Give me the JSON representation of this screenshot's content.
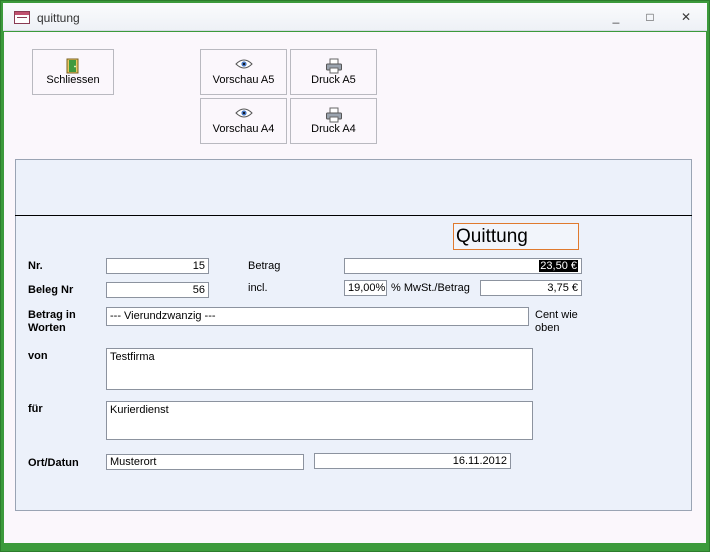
{
  "window": {
    "title": "quittung",
    "controls": {
      "minimize": "_",
      "maximize": "□",
      "close": "✕"
    }
  },
  "toolbar": {
    "close_label": "Schliessen",
    "preview_a5_label": "Vorschau A5",
    "print_a5_label": "Druck A5",
    "preview_a4_label": "Vorschau A4",
    "print_a4_label": "Druck A4"
  },
  "form": {
    "heading": "Quittung",
    "nr_label": "Nr.",
    "nr_value": "15",
    "beleg_label": "Beleg Nr",
    "beleg_value": "56",
    "betrag_label": "Betrag",
    "betrag_value": "23,50 €",
    "incl_label": "incl.",
    "mwst_percent": "19,00%",
    "mwst_label": "% MwSt./Betrag",
    "mwst_amount": "3,75 €",
    "betrag_worten_label_line1": "Betrag in",
    "betrag_worten_label_line2": "Worten",
    "betrag_worten_value": "--- Vierundzwanzig ---",
    "cent_note_line1": "Cent wie",
    "cent_note_line2": "oben",
    "von_label": "von",
    "von_value": "Testfirma",
    "fuer_label": "für",
    "fuer_value": "Kurierdienst",
    "ort_datum_label": "Ort/Datun",
    "ort_value": "Musterort",
    "datum_value": "16.11.2012"
  }
}
